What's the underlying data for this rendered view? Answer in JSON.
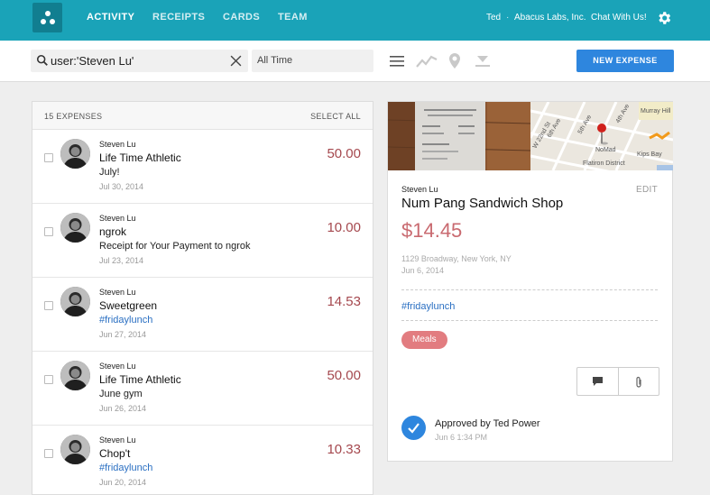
{
  "nav": {
    "items": [
      {
        "label": "ACTIVITY",
        "active": true
      },
      {
        "label": "RECEIPTS",
        "active": false
      },
      {
        "label": "CARDS",
        "active": false
      },
      {
        "label": "TEAM",
        "active": false
      }
    ],
    "user": "Ted",
    "separator": "·",
    "company": "Abacus Labs, Inc.",
    "chat": "Chat With Us!",
    "settings_icon": "gear-icon"
  },
  "toolbar": {
    "search_value": "user:'Steven Lu'",
    "date_filter": "All Time",
    "new_expense": "NEW EXPENSE",
    "view_icons": [
      "list-view-icon",
      "chart-view-icon",
      "map-view-icon",
      "download-view-icon"
    ]
  },
  "list": {
    "count_label": "15 EXPENSES",
    "select_all": "SELECT ALL",
    "rows": [
      {
        "user": "Steven Lu",
        "merchant": "Life Time Athletic",
        "note": "July!",
        "note_is_tag": false,
        "date": "Jul 30, 2014",
        "amount": "50.00"
      },
      {
        "user": "Steven Lu",
        "merchant": "ngrok",
        "note": "Receipt for Your Payment to ngrok",
        "note_is_tag": false,
        "date": "Jul 23, 2014",
        "amount": "10.00"
      },
      {
        "user": "Steven Lu",
        "merchant": "Sweetgreen",
        "note": "#fridaylunch",
        "note_is_tag": true,
        "date": "Jun 27, 2014",
        "amount": "14.53"
      },
      {
        "user": "Steven Lu",
        "merchant": "Life Time Athletic",
        "note": "June gym",
        "note_is_tag": false,
        "date": "Jun 26, 2014",
        "amount": "50.00"
      },
      {
        "user": "Steven Lu",
        "merchant": "Chop't",
        "note": "#fridaylunch",
        "note_is_tag": true,
        "date": "Jun 20, 2014",
        "amount": "10.33"
      }
    ]
  },
  "detail": {
    "user": "Steven Lu",
    "edit": "EDIT",
    "merchant": "Num Pang Sandwich Shop",
    "amount": "$14.45",
    "address": "1129 Broadway, New York, NY",
    "date": "Jun 6, 2014",
    "tag": "#fridaylunch",
    "category": "Meals",
    "approval": "Approved by Ted Power",
    "approval_time": "Jun 6 1:34 PM",
    "map_labels": {
      "ave1": "6th Ave",
      "ave2": "5th Ave",
      "ave3": "4th Ave",
      "street1": "W 22nd St",
      "place": "Murray Hill",
      "poi": "NoMad",
      "area": "Kips Bay",
      "district": "Flatiron District"
    }
  },
  "colors": {
    "nav_bg": "#1aa3b8",
    "primary_button": "#2e86de",
    "amount": "#a5484e",
    "detail_amount": "#c96a70",
    "category_pill": "#e27c80",
    "tag_link": "#2a6fc2"
  }
}
